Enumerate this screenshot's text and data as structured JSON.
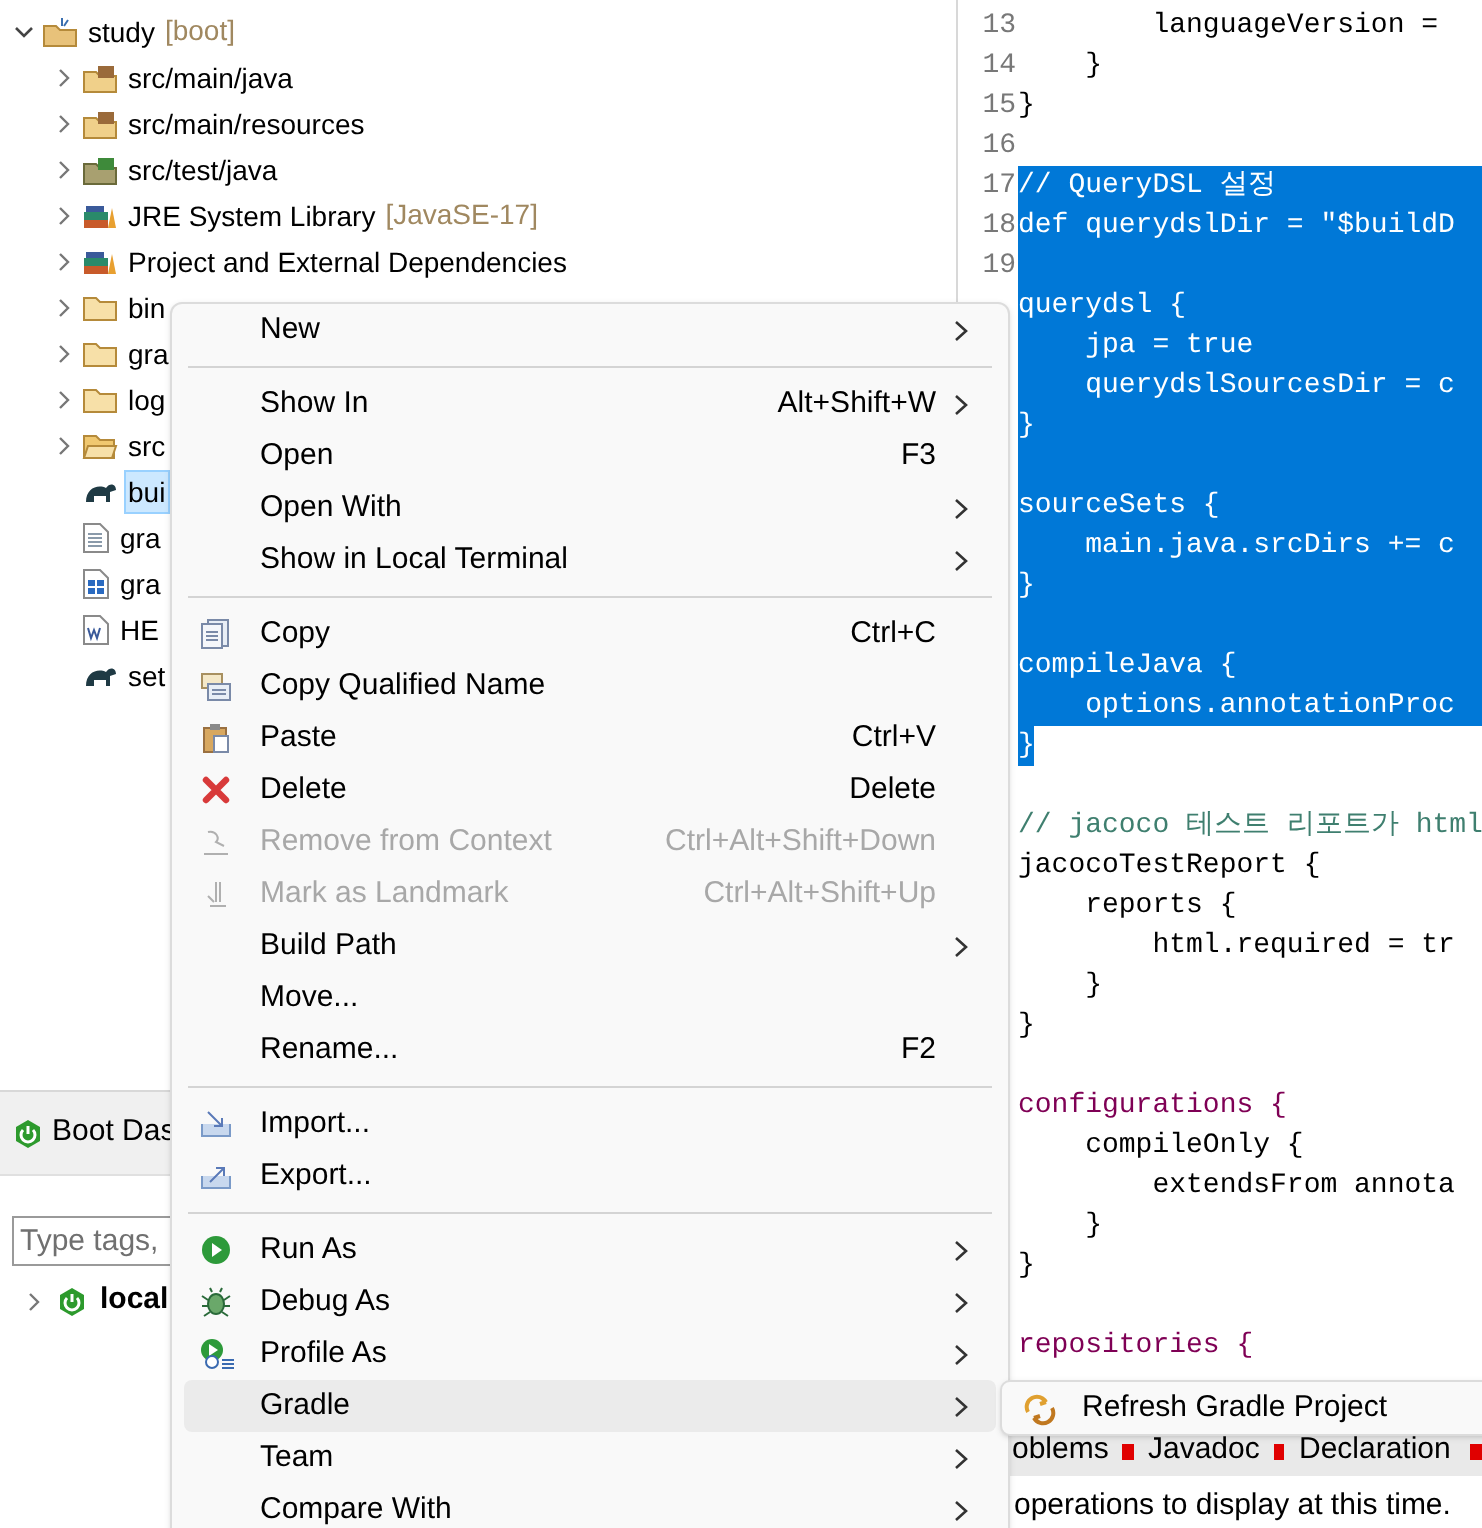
{
  "explorer": {
    "tree": [
      {
        "label": "study",
        "decoration": "[boot]",
        "kind": "project",
        "expanded": true,
        "selected": false,
        "children": [
          {
            "label": "src/main/java",
            "kind": "source-folder",
            "expanded": false,
            "selected": false
          },
          {
            "label": "src/main/resources",
            "kind": "source-folder",
            "expanded": false,
            "selected": false
          },
          {
            "label": "src/test/java",
            "kind": "test-folder",
            "expanded": false,
            "selected": false
          },
          {
            "label": "JRE System Library",
            "decoration": "[JavaSE-17]",
            "kind": "library",
            "expanded": false,
            "selected": false
          },
          {
            "label": "Project and External Dependencies",
            "kind": "library",
            "expanded": false,
            "selected": false
          },
          {
            "label": "bin",
            "kind": "folder",
            "expanded": false,
            "selected": false
          },
          {
            "label": "gra",
            "kind": "folder",
            "expanded": false,
            "selected": false
          },
          {
            "label": "log",
            "kind": "folder",
            "expanded": false,
            "selected": false
          },
          {
            "label": "src",
            "kind": "open-folder",
            "expanded": false,
            "selected": false
          },
          {
            "label": "bui",
            "kind": "gradle-file",
            "selected": true
          },
          {
            "label": "gra",
            "kind": "text-file",
            "selected": false
          },
          {
            "label": "gra",
            "kind": "grid-file",
            "selected": false
          },
          {
            "label": "HE",
            "kind": "doc-file",
            "selected": false
          },
          {
            "label": "set",
            "kind": "gradle-file",
            "selected": false
          }
        ]
      }
    ]
  },
  "boot_dashboard": {
    "title": "Boot Das",
    "filter": {
      "placeholder": "Type tags,"
    },
    "items": [
      {
        "label": "local",
        "expanded": false
      }
    ]
  },
  "editor": {
    "lines": [
      {
        "number": "13",
        "text": "        languageVersion =",
        "kind": "code",
        "selected": false
      },
      {
        "number": "14",
        "text": "    }",
        "kind": "code",
        "selected": false
      },
      {
        "number": "15",
        "text": "}",
        "kind": "code",
        "selected": false
      },
      {
        "number": "16",
        "kind": "code",
        "selected": false
      },
      {
        "number": "17",
        "text": "// QueryDSL 설정",
        "selected": true
      },
      {
        "number": "18",
        "text": "def querydslDir = \"$buildD",
        "selected": true
      },
      {
        "number": "19",
        "selected": true
      },
      {
        "text": "querydsl {",
        "selected": true
      },
      {
        "text": "    jpa = true",
        "selected": true
      },
      {
        "text": "    querydslSourcesDir = c",
        "selected": true
      },
      {
        "text": "}",
        "selected": true
      },
      {
        "selected": true
      },
      {
        "text": "sourceSets {",
        "selected": true
      },
      {
        "text": "    main.java.srcDirs += c",
        "selected": true
      },
      {
        "text": "}",
        "selected": true
      },
      {
        "selected": true
      },
      {
        "text": "compileJava {",
        "selected": true
      },
      {
        "text": "    options.annotationProc",
        "selected": true
      },
      {
        "text": "}",
        "selected": true
      },
      {
        "kind": "code",
        "selected": false
      },
      {
        "text": "// jacoco 테스트 리포트가 html",
        "kind": "comment",
        "selected": false
      },
      {
        "text": "jacocoTestReport {",
        "kind": "code",
        "selected": false
      },
      {
        "text": "    reports {",
        "kind": "code",
        "selected": false
      },
      {
        "text": "        html.required = tr",
        "kind": "code",
        "selected": false
      },
      {
        "text": "    }",
        "kind": "code",
        "selected": false
      },
      {
        "text": "}",
        "kind": "code",
        "selected": false
      },
      {
        "kind": "code",
        "selected": false
      },
      {
        "text": "configurations {",
        "kind": "keyword",
        "selected": false
      },
      {
        "text": "    compileOnly {",
        "kind": "code",
        "selected": false
      },
      {
        "text": "        extendsFrom annota",
        "kind": "code",
        "selected": false
      },
      {
        "text": "    }",
        "kind": "code",
        "selected": false
      },
      {
        "text": "}",
        "kind": "code",
        "selected": false
      },
      {
        "kind": "code",
        "selected": false
      },
      {
        "text": "repositories {",
        "kind": "keyword",
        "selected": false
      }
    ]
  },
  "bottom_panel": {
    "tabs": [
      {
        "label": "oblems"
      },
      {
        "label": "Javadoc"
      },
      {
        "label": "Declaration"
      }
    ],
    "message": "operations to display at this time."
  },
  "context_menu": {
    "items": [
      {
        "kind": "item",
        "label": "New",
        "submenu": true,
        "disabled": false,
        "highlighted": false
      },
      {
        "kind": "separator"
      },
      {
        "kind": "item",
        "label": "Show In",
        "shortcut": "Alt+Shift+W",
        "submenu": true,
        "disabled": false,
        "highlighted": false
      },
      {
        "kind": "item",
        "label": "Open",
        "shortcut": "F3",
        "submenu": false,
        "disabled": false,
        "highlighted": false
      },
      {
        "kind": "item",
        "label": "Open With",
        "submenu": true,
        "disabled": false,
        "highlighted": false
      },
      {
        "kind": "item",
        "label": "Show in Local Terminal",
        "submenu": true,
        "disabled": false,
        "highlighted": false
      },
      {
        "kind": "separator"
      },
      {
        "kind": "item",
        "label": "Copy",
        "shortcut": "Ctrl+C",
        "submenu": false,
        "disabled": false,
        "highlighted": false
      },
      {
        "kind": "item",
        "label": "Copy Qualified Name",
        "submenu": false,
        "disabled": false,
        "highlighted": false
      },
      {
        "kind": "item",
        "label": "Paste",
        "shortcut": "Ctrl+V",
        "submenu": false,
        "disabled": false,
        "highlighted": false
      },
      {
        "kind": "item",
        "label": "Delete",
        "shortcut": "Delete",
        "submenu": false,
        "disabled": false,
        "highlighted": false
      },
      {
        "kind": "item",
        "label": "Remove from Context",
        "shortcut": "Ctrl+Alt+Shift+Down",
        "submenu": false,
        "disabled": true,
        "highlighted": false
      },
      {
        "kind": "item",
        "label": "Mark as Landmark",
        "shortcut": "Ctrl+Alt+Shift+Up",
        "submenu": false,
        "disabled": true,
        "highlighted": false
      },
      {
        "kind": "item",
        "label": "Build Path",
        "submenu": true,
        "disabled": false,
        "highlighted": false
      },
      {
        "kind": "item",
        "label": "Move...",
        "submenu": false,
        "disabled": false,
        "highlighted": false
      },
      {
        "kind": "item",
        "label": "Rename...",
        "shortcut": "F2",
        "submenu": false,
        "disabled": false,
        "highlighted": false
      },
      {
        "kind": "separator"
      },
      {
        "kind": "item",
        "label": "Import...",
        "submenu": false,
        "disabled": false,
        "highlighted": false
      },
      {
        "kind": "item",
        "label": "Export...",
        "submenu": false,
        "disabled": false,
        "highlighted": false
      },
      {
        "kind": "separator"
      },
      {
        "kind": "item",
        "label": "Run As",
        "submenu": true,
        "disabled": false,
        "highlighted": false
      },
      {
        "kind": "item",
        "label": "Debug As",
        "submenu": true,
        "disabled": false,
        "highlighted": false
      },
      {
        "kind": "item",
        "label": "Profile As",
        "submenu": true,
        "disabled": false,
        "highlighted": false
      },
      {
        "kind": "item",
        "label": "Gradle",
        "submenu": true,
        "disabled": false,
        "highlighted": true
      },
      {
        "kind": "item",
        "label": "Team",
        "submenu": true,
        "disabled": false,
        "highlighted": false
      },
      {
        "kind": "item",
        "label": "Compare With",
        "submenu": true,
        "disabled": false,
        "highlighted": false
      }
    ]
  },
  "submenu": {
    "items": [
      {
        "label": "Refresh Gradle Project"
      }
    ]
  }
}
